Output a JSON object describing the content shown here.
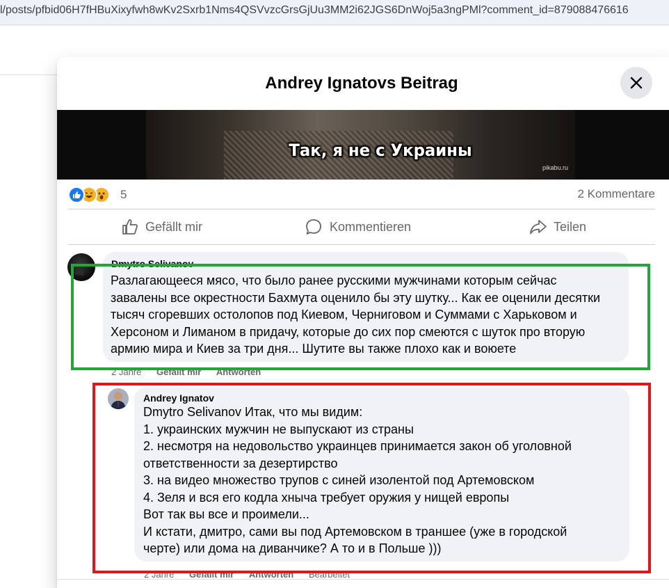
{
  "browser": {
    "url": "l/posts/pfbid06H7fHBuXixyfwh8wKv2Sxrb1Nms4QSVvzcGrsGjUu3MM2i62JGS6DnWoj5a3ngPMl?comment_id=879088476616"
  },
  "modal": {
    "title": "Andrey Ignatovs Beitrag",
    "close_icon": "close-icon"
  },
  "post": {
    "image_caption": "Так, я не с Украины",
    "watermark": "pikabu.ru",
    "reactions": {
      "icons": [
        "like-icon",
        "haha-icon",
        "wow-icon"
      ],
      "count": "5"
    },
    "comment_count": "2 Kommentare"
  },
  "actions": {
    "like": "Gefällt mir",
    "comment": "Kommentieren",
    "share": "Teilen"
  },
  "comments": [
    {
      "author": "Dmytro Selivanov",
      "lines": [
        "Разлагающееся мясо, что было ранее русскими мужчинами которым сейчас",
        "завалены все окрестности Бахмута оценило бы эту шутку... Как ее оценили десятки",
        "тысяч сгоревших остолопов под Киевом, Черниговом и Суммами с Харьковом и",
        "Херсоном и Лиманом в придачу, которые до сих пор смеются с шуток про вторую",
        "армию мира и Киев за три дня... Шутите вы также плохо как и воюете"
      ],
      "meta": {
        "time": "2 Jahre",
        "like": "Gefällt mir",
        "reply": "Antworten"
      }
    },
    {
      "author": "Andrey Ignatov",
      "lines": [
        "Dmytro Selivanov Итак, что мы видим:",
        "1. украинских мужчин не выпускают из страны",
        "2. несмотря на недовольство украинцев принимается закон об уголовной",
        "ответственности за дезертирство",
        "3. на видео множество трупов с синей изолентой под Артемовском",
        "4. Зеля и вся его кодла хныча требует оружия у нищей европы",
        "Вот так вы все и проимели...",
        "И кстати, дмитро, сами вы под Артемовском в траншее (уже в городской",
        "черте) или дома на диванчике? А то и в Польше )))"
      ],
      "meta": {
        "time": "2 Jahre",
        "like": "Gefällt mir",
        "reply": "Antworten",
        "edited": "Bearbeitet"
      }
    }
  ],
  "colors": {
    "highlight_green": "#21a637",
    "highlight_red": "#e0161b",
    "like_blue": "#1877f2"
  }
}
